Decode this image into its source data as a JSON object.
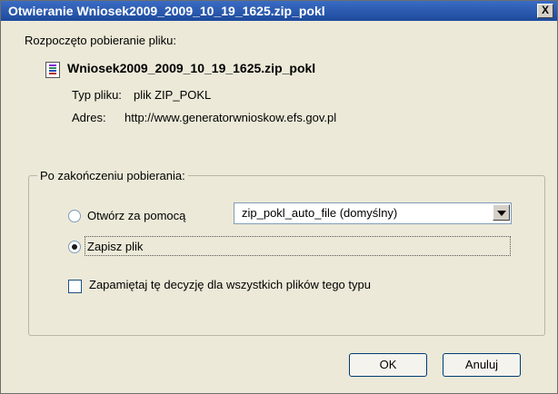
{
  "window": {
    "title": "Otwieranie Wniosek2009_2009_10_19_1625.zip_pokl",
    "close_label": "X"
  },
  "download": {
    "intro": "Rozpoczęto pobieranie pliku:",
    "file_name": "Wniosek2009_2009_10_19_1625.zip_pokl",
    "type_label": "Typ pliku:",
    "type_value": "plik ZIP_POKL",
    "address_label": "Adres:",
    "address_value": "http://www.generatorwnioskow.efs.gov.pl"
  },
  "after_download": {
    "legend": "Po zakończeniu pobierania:",
    "open_with_label": "Otwórz za pomocą",
    "open_with_selected": false,
    "app_select_value": "zip_pokl_auto_file (domyślny)",
    "save_label": "Zapisz plik",
    "save_selected": true,
    "remember_label": "Zapamiętaj tę decyzję dla wszystkich plików tego typu",
    "remember_checked": false
  },
  "buttons": {
    "ok": "OK",
    "cancel": "Anuluj"
  },
  "colors": {
    "titlebar": "#2f5aa8",
    "dialog_background": "#ece9d8"
  },
  "icons": {
    "file": "winrar-archive-icon"
  }
}
